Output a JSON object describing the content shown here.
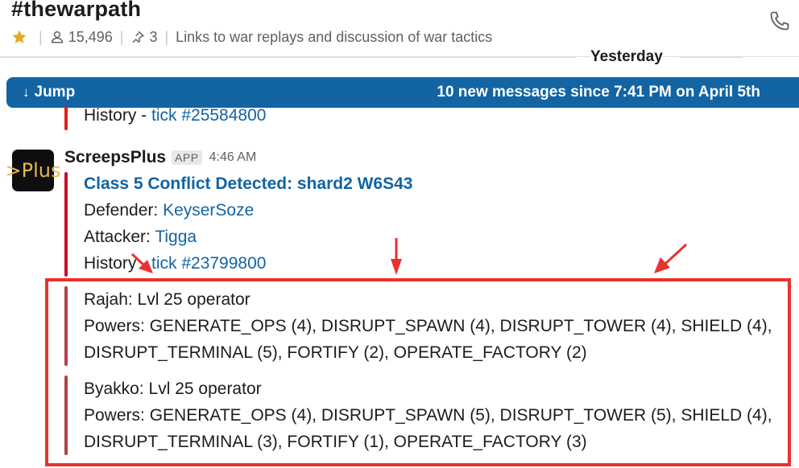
{
  "channel": {
    "name": "#thewarpath",
    "members": "15,496",
    "pins": "3",
    "topic": "Links to war replays and discussion of war tactics"
  },
  "divider": {
    "date_label": "Yesterday"
  },
  "jump_bar": {
    "label": "Jump",
    "text": "10 new messages since 7:41 PM on April 5th"
  },
  "previous_attachment": {
    "history_label": "History - ",
    "history_link": "tick #25584800"
  },
  "message": {
    "avatar_text": ">Plus",
    "sender": "ScreepsPlus",
    "badge": "APP",
    "time": "4:46 AM",
    "attachment": {
      "title": "Class 5 Conflict Detected: shard2 W6S43",
      "defender_label": "Defender: ",
      "defender": "KeyserSoze",
      "attacker_label": "Attacker: ",
      "attacker": "Tigga",
      "history_label": "History - ",
      "history_link": "tick #23799800"
    },
    "operators": [
      {
        "name_line": "Rajah: Lvl 25 operator",
        "powers_line_1": "Powers: GENERATE_OPS (4), DISRUPT_SPAWN (4), DISRUPT_TOWER (4), SHIELD (4),",
        "powers_line_2": "DISRUPT_TERMINAL (5), FORTIFY (2), OPERATE_FACTORY (2)"
      },
      {
        "name_line": "Byakko: Lvl 25 operator",
        "powers_line_1": "Powers: GENERATE_OPS (4), DISRUPT_SPAWN (5), DISRUPT_TOWER (5), SHIELD (4),",
        "powers_line_2": "DISRUPT_TERMINAL (3), FORTIFY (1), OPERATE_FACTORY (3)"
      }
    ]
  },
  "colors": {
    "link": "#1264a3",
    "jump_bar": "#1264a3",
    "annotation_red": "#e8322f",
    "star": "#e8a723"
  },
  "icons": {
    "star": "star-icon",
    "members": "person-icon",
    "pins": "pin-icon",
    "call": "phone-icon",
    "jump": "arrow-down-icon"
  }
}
